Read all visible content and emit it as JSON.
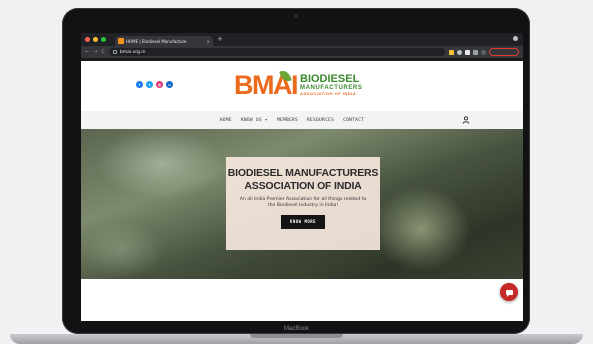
{
  "device": {
    "label": "MacBook"
  },
  "browser": {
    "tab_title": "HOME | Biodiesel Manufacture",
    "tab_close": "×",
    "new_tab": "+",
    "url": "bmai.org.in",
    "nav": {
      "back": "←",
      "forward": "→",
      "reload": "C"
    }
  },
  "site": {
    "social": [
      {
        "name": "facebook-icon",
        "glyph": "f",
        "color": "#1877f2"
      },
      {
        "name": "twitter-icon",
        "glyph": "t",
        "color": "#1da1f2"
      },
      {
        "name": "instagram-icon",
        "glyph": "◎",
        "color": "#e1306c"
      },
      {
        "name": "linkedin-icon",
        "glyph": "in",
        "color": "#0a66c2"
      }
    ],
    "logo": {
      "mark": "BMAI",
      "line1": "BIODIESEL",
      "line2": "MANUFACTURERS",
      "line3": "ASSOCIATION OF INDIA"
    },
    "nav": {
      "home": "HOME",
      "know_us": "KNOW US ▾",
      "members": "MEMBERS",
      "resources": "RESOURCES",
      "contact": "CONTACT"
    },
    "hero": {
      "title_line1": "BIODIESEL MANUFACTURERS",
      "title_line2": "ASSOCIATION OF INDIA",
      "subtitle": "An all India Premier Association for all things related to the Biodiesel Industry in India!",
      "button": "KNOW MORE"
    },
    "colors": {
      "orange": "#ec6a1c",
      "green": "#3a8a2e",
      "chat": "#c62828"
    }
  }
}
